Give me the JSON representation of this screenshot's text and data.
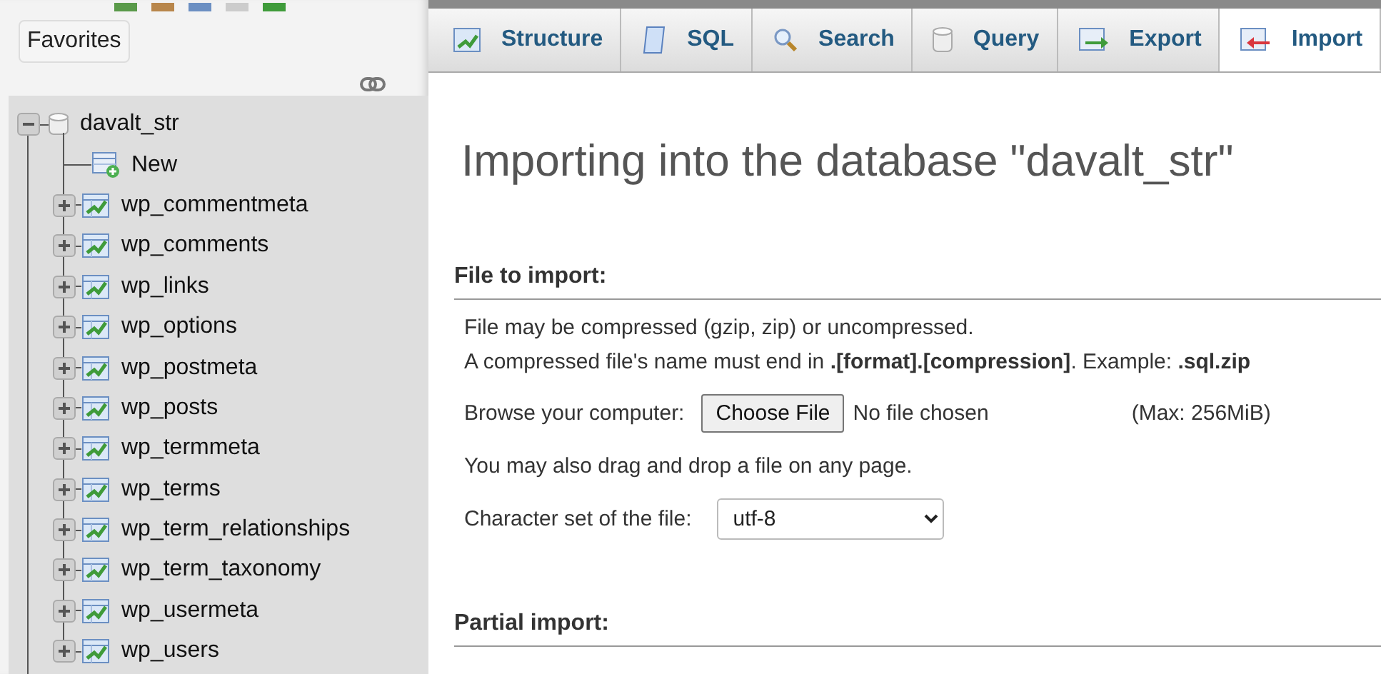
{
  "sidebar": {
    "favorites_button": "Favorites",
    "tree": {
      "name": "davalt_str",
      "expanded": true,
      "children": [
        {
          "kind": "new",
          "name": "New"
        },
        {
          "kind": "table",
          "name": "wp_commentmeta",
          "expanded": false
        },
        {
          "kind": "table",
          "name": "wp_comments",
          "expanded": false
        },
        {
          "kind": "table",
          "name": "wp_links",
          "expanded": false
        },
        {
          "kind": "table",
          "name": "wp_options",
          "expanded": false
        },
        {
          "kind": "table",
          "name": "wp_postmeta",
          "expanded": false
        },
        {
          "kind": "table",
          "name": "wp_posts",
          "expanded": false
        },
        {
          "kind": "table",
          "name": "wp_termmeta",
          "expanded": false
        },
        {
          "kind": "table",
          "name": "wp_terms",
          "expanded": false
        },
        {
          "kind": "table",
          "name": "wp_term_relationships",
          "expanded": false
        },
        {
          "kind": "table",
          "name": "wp_term_taxonomy",
          "expanded": false
        },
        {
          "kind": "table",
          "name": "wp_usermeta",
          "expanded": false
        },
        {
          "kind": "table",
          "name": "wp_users",
          "expanded": false
        }
      ]
    }
  },
  "tabs": [
    {
      "kind": "structure",
      "label": "Structure",
      "selected": false
    },
    {
      "kind": "sql",
      "label": "SQL",
      "selected": false
    },
    {
      "kind": "search",
      "label": "Search",
      "selected": false
    },
    {
      "kind": "query",
      "label": "Query",
      "selected": false
    },
    {
      "kind": "export",
      "label": "Export",
      "selected": false
    },
    {
      "kind": "import",
      "label": "Import",
      "selected": true
    }
  ],
  "page_title": "Importing into the database \"davalt_str\"",
  "file_section": {
    "heading": "File to import:",
    "notes": [
      "File may be compressed (gzip, zip) or uncompressed.",
      "A compressed file's name must end in **.[format].[compression]**. Example: **.sql.zip**"
    ],
    "browse_label": "Browse your computer:",
    "choose_button": "Choose File",
    "file_status": "No file chosen",
    "max_size": "(Max: 256MiB)",
    "drag_note": "You may also drag and drop a file on any page.",
    "charset_label": "Character set of the file:",
    "charset_value": "utf-8"
  },
  "partial_section": {
    "heading": "Partial import:"
  }
}
